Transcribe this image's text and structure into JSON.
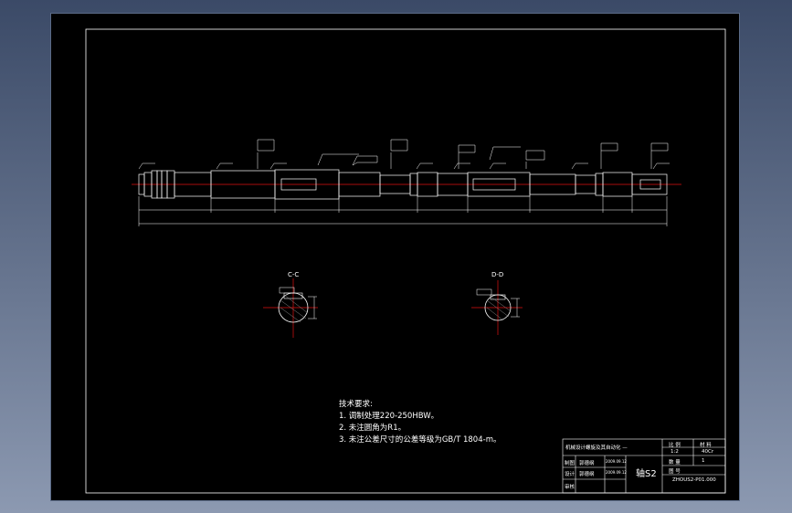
{
  "drawing": {
    "part_name": "轴S2",
    "section_labels": {
      "cc": "C-C",
      "dd": "D-D"
    },
    "technical_requirements": {
      "heading": "技术要求:",
      "items": [
        "1.  调制处理220-250HBW。",
        "2.  未注圆角为R1。",
        "3.  未注公差尺寸的公差等级为GB/T 1804-m。"
      ]
    },
    "title_block": {
      "project_title": "机械设计螺旋及其自动化 —",
      "scale_label": "比 例",
      "scale_value": "1:2",
      "material_label": "材 料",
      "material_value": "40Cr",
      "quantity_label": "数 量",
      "quantity_value": "1",
      "sheet_label": "图 号",
      "rows": [
        {
          "role": "制图",
          "name": "郭德纲",
          "date": "2009.09.12"
        },
        {
          "role": "设计",
          "name": "郭德纲",
          "date": "2009.09.12"
        },
        {
          "role": "审核",
          "name": "",
          "date": ""
        }
      ],
      "drawing_no": "ZHOUS2-P01.000"
    }
  }
}
